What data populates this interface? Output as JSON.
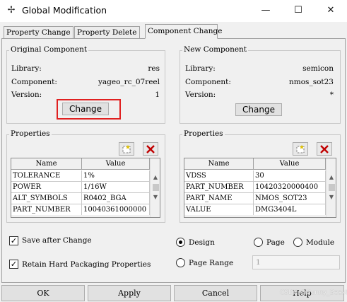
{
  "window": {
    "title": "Global Modification",
    "app_icon": "pin-icon"
  },
  "window_controls": {
    "minimize": "—",
    "maximize": "☐",
    "close": "✕"
  },
  "tabs": [
    {
      "label": "Property Change",
      "active": false
    },
    {
      "label": "Property Delete",
      "active": false
    },
    {
      "label": "Component Change",
      "active": true
    }
  ],
  "original": {
    "title": "Original Component",
    "library_label": "Library:",
    "library": "res",
    "component_label": "Component:",
    "component": "yageo_rc_07reel",
    "version_label": "Version:",
    "version": "1",
    "change_button": "Change"
  },
  "new": {
    "title": "New Component",
    "library_label": "Library:",
    "library": "semicon",
    "component_label": "Component:",
    "component": "nmos_sot23",
    "version_label": "Version:",
    "version": "*",
    "change_button": "Change"
  },
  "props_left": {
    "title": "Properties",
    "columns": [
      "Name",
      "Value"
    ],
    "rows": [
      [
        "TOLERANCE",
        "1%"
      ],
      [
        "POWER",
        "1/16W"
      ],
      [
        "ALT_SYMBOLS",
        "R0402_BGA"
      ],
      [
        "PART_NUMBER",
        "10040361000000"
      ]
    ]
  },
  "props_right": {
    "title": "Properties",
    "columns": [
      "Name",
      "Value"
    ],
    "rows": [
      [
        "VDSS",
        "30"
      ],
      [
        "PART_NUMBER",
        "10420320000400"
      ],
      [
        "PART_NAME",
        "NMOS_SOT23"
      ],
      [
        "VALUE",
        "DMG3404L"
      ]
    ]
  },
  "options": {
    "save_after_change": {
      "label": "Save after Change",
      "checked": true
    },
    "retain_packaging": {
      "label": "Retain Hard Packaging Properties",
      "checked": true
    },
    "scope": {
      "design": "Design",
      "page": "Page",
      "module": "Module",
      "page_range": "Page Range",
      "selected": "Design"
    },
    "page_range_value": "1"
  },
  "buttons": {
    "ok": "OK",
    "apply": "Apply",
    "cancel": "Cancel",
    "help": "Help"
  },
  "watermark": "CSDN @Bunny_Beast",
  "colors": {
    "highlight_box": "#e02020",
    "delete_red": "#c00000"
  }
}
